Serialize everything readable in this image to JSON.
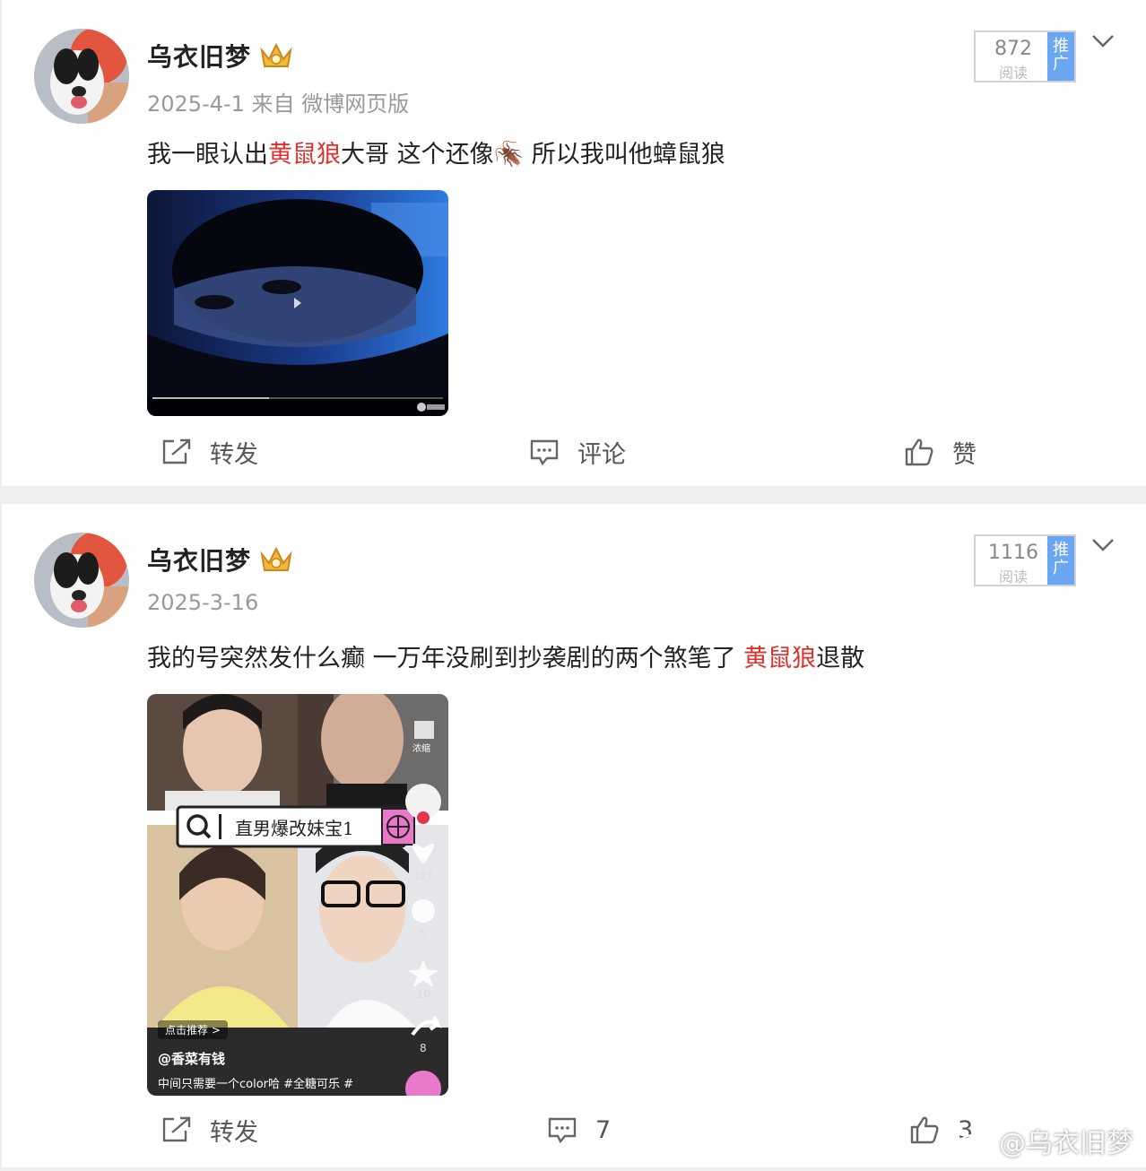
{
  "posts": [
    {
      "author": "乌衣旧梦",
      "date": "2025-4-1",
      "source": "来自 微博网页版",
      "text_before": "我一眼认出",
      "text_highlight": "黄鼠狼",
      "text_after": "大哥 这个还像🪳 所以我叫他蟑鼠狼",
      "reads": "872",
      "reads_label": "阅读",
      "promote_label": "推广",
      "media_type": "video",
      "actions": {
        "repost": "转发",
        "comment": "评论",
        "like": "赞"
      }
    },
    {
      "author": "乌衣旧梦",
      "date": "2025-3-16",
      "source": "",
      "text_before": "我的号突然发什么癫 一万年没刷到抄袭剧的两个煞笔了 ",
      "text_highlight": "黄鼠狼",
      "text_after": "退散",
      "reads": "1116",
      "reads_label": "阅读",
      "promote_label": "推广",
      "media_type": "image",
      "media_overlay": {
        "search_text": "直男爆改妹宝1",
        "recommend": "点击推荐 >",
        "account": "@香菜有钱",
        "caption": "中间只需要一个color哈 #全糖可乐 #",
        "side_counts": [
          "327",
          "5",
          "10",
          "8"
        ],
        "side_top_label": "浓缩"
      },
      "actions": {
        "repost": "转发",
        "comment": "7",
        "like": "3"
      }
    }
  ],
  "watermark": "@乌衣旧梦",
  "colors": {
    "highlight": "#e0302e",
    "promote": "#6aa6f2",
    "background": "#efeff1"
  }
}
